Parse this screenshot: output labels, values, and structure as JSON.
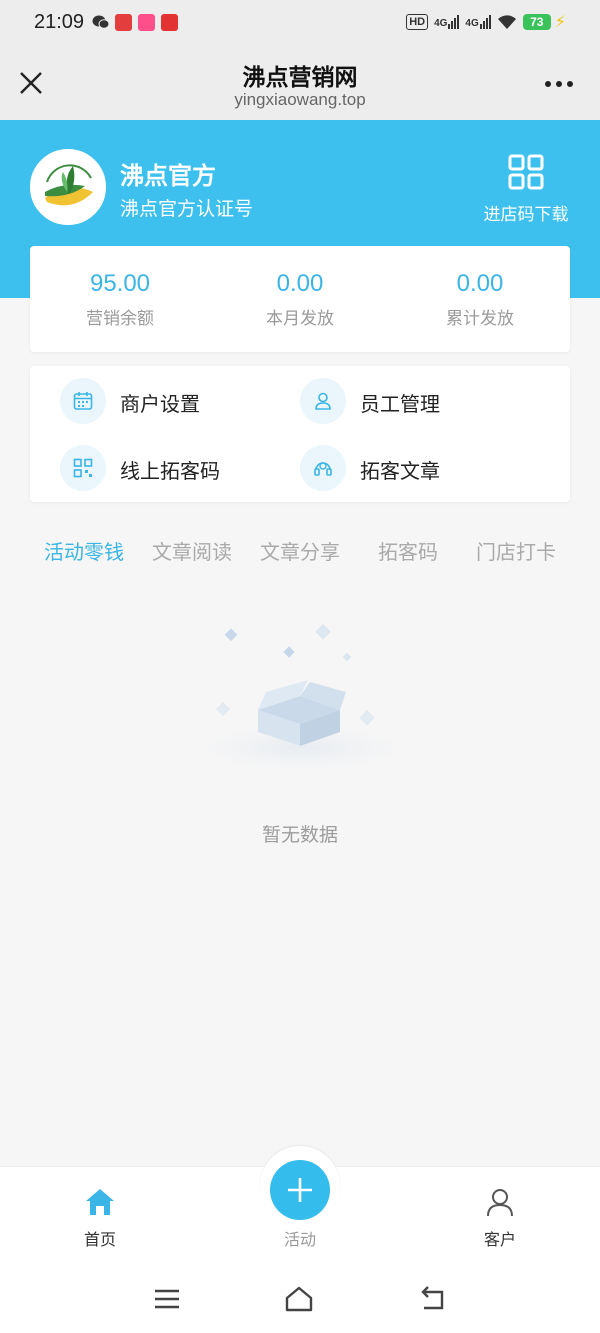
{
  "status_bar": {
    "time": "21:09",
    "hd": "HD",
    "network1": "4G",
    "network2": "4G",
    "battery": "73"
  },
  "title_bar": {
    "title": "沸点营销网",
    "url": "yingxiaowang.top"
  },
  "header": {
    "name": "沸点官方",
    "subtitle": "沸点官方认证号",
    "qr_label": "进店码下载",
    "bg_color": "#3ec0ef"
  },
  "stats": [
    {
      "value": "95.00",
      "label": "营销余额"
    },
    {
      "value": "0.00",
      "label": "本月发放"
    },
    {
      "value": "0.00",
      "label": "累计发放"
    }
  ],
  "functions": [
    {
      "label": "商户设置",
      "icon": "calendar-icon"
    },
    {
      "label": "员工管理",
      "icon": "user-icon"
    },
    {
      "label": "线上拓客码",
      "icon": "qrcode-icon"
    },
    {
      "label": "拓客文章",
      "icon": "headset-icon"
    }
  ],
  "tabs": [
    "活动零钱",
    "文章阅读",
    "文章分享",
    "拓客码",
    "门店打卡"
  ],
  "active_tab": "活动零钱",
  "empty_text": "暂无数据",
  "bottom_nav": {
    "home": "首页",
    "activity": "活动",
    "customer": "客户"
  },
  "accent_color": "#3ab5e6"
}
